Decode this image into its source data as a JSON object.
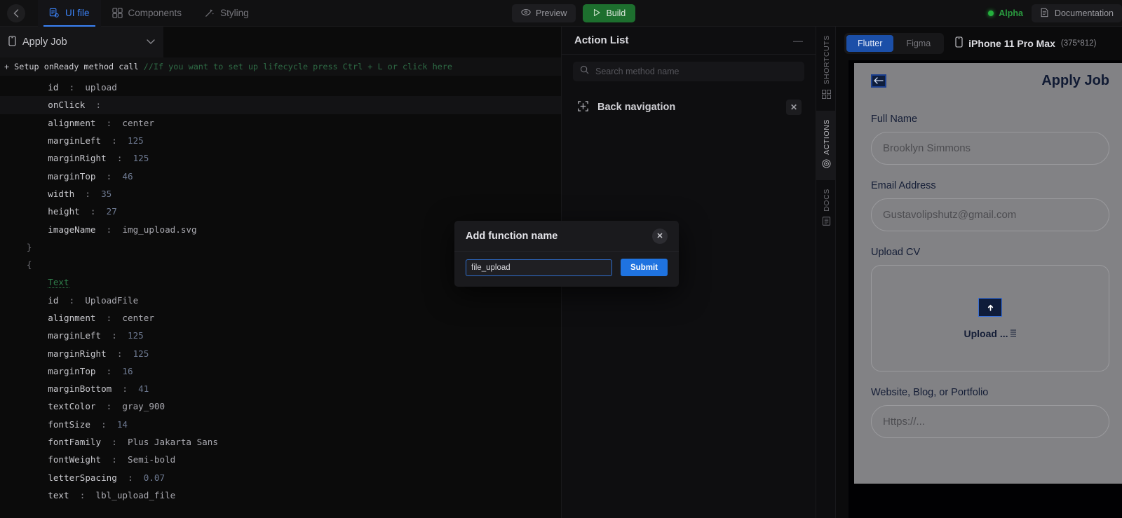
{
  "topbar": {
    "back_icon": "chevron-left-icon",
    "tabs": [
      {
        "label": "UI file",
        "icon": "ui-file-icon",
        "active": true
      },
      {
        "label": "Components",
        "icon": "components-grid-icon",
        "active": false
      },
      {
        "label": "Styling",
        "icon": "magic-wand-icon",
        "active": false
      }
    ],
    "preview_label": "Preview",
    "build_label": "Build",
    "alpha_label": "Alpha",
    "documentation_label": "Documentation"
  },
  "editor": {
    "file_name": "Apply Job",
    "onready": {
      "plus": "+",
      "label": "Setup onReady method call",
      "comment": "//If you want to set up lifecycle press Ctrl + L or click here"
    },
    "lines": [
      {
        "indent": 3,
        "key": "id",
        "colon": ":",
        "value": "upload",
        "vtype": "str",
        "hl": false
      },
      {
        "indent": 3,
        "key": "onClick",
        "colon": ":",
        "value": "",
        "vtype": "str",
        "hl": true
      },
      {
        "indent": 3,
        "key": "alignment",
        "colon": ":",
        "value": "center",
        "vtype": "str",
        "hl": false
      },
      {
        "indent": 3,
        "key": "marginLeft",
        "colon": ":",
        "value": "125",
        "vtype": "num",
        "hl": false
      },
      {
        "indent": 3,
        "key": "marginRight",
        "colon": ":",
        "value": "125",
        "vtype": "num",
        "hl": false
      },
      {
        "indent": 3,
        "key": "marginTop",
        "colon": ":",
        "value": "46",
        "vtype": "num",
        "hl": false
      },
      {
        "indent": 3,
        "key": "width",
        "colon": ":",
        "value": "35",
        "vtype": "num",
        "hl": false
      },
      {
        "indent": 3,
        "key": "height",
        "colon": ":",
        "value": "27",
        "vtype": "num",
        "hl": false
      },
      {
        "indent": 3,
        "key": "imageName",
        "colon": ":",
        "value": "img_upload.svg",
        "vtype": "str",
        "hl": false
      },
      {
        "indent": 2,
        "brace": "}",
        "hl": false
      },
      {
        "indent": 2,
        "brace": "{",
        "hl": false
      },
      {
        "indent": 3,
        "type": "Text",
        "hl": false
      },
      {
        "indent": 3,
        "key": "id",
        "colon": ":",
        "value": "UploadFile",
        "vtype": "str",
        "hl": false
      },
      {
        "indent": 3,
        "key": "alignment",
        "colon": ":",
        "value": "center",
        "vtype": "str",
        "hl": false
      },
      {
        "indent": 3,
        "key": "marginLeft",
        "colon": ":",
        "value": "125",
        "vtype": "num",
        "hl": false
      },
      {
        "indent": 3,
        "key": "marginRight",
        "colon": ":",
        "value": "125",
        "vtype": "num",
        "hl": false
      },
      {
        "indent": 3,
        "key": "marginTop",
        "colon": ":",
        "value": "16",
        "vtype": "num",
        "hl": false
      },
      {
        "indent": 3,
        "key": "marginBottom",
        "colon": ":",
        "value": "41",
        "vtype": "num",
        "hl": false
      },
      {
        "indent": 3,
        "key": "textColor",
        "colon": ":",
        "value": "gray_900",
        "vtype": "str",
        "hl": false
      },
      {
        "indent": 3,
        "key": "fontSize",
        "colon": ":",
        "value": "14",
        "vtype": "num",
        "hl": false
      },
      {
        "indent": 3,
        "key": "fontFamily",
        "colon": ":",
        "value": "Plus Jakarta Sans",
        "vtype": "str",
        "hl": false
      },
      {
        "indent": 3,
        "key": "fontWeight",
        "colon": ":",
        "value": "Semi-bold",
        "vtype": "str",
        "hl": false
      },
      {
        "indent": 3,
        "key": "letterSpacing",
        "colon": ":",
        "value": "0.07",
        "vtype": "num",
        "hl": false
      },
      {
        "indent": 3,
        "key": "text",
        "colon": ":",
        "value": "lbl_upload_file",
        "vtype": "str",
        "hl": false
      }
    ]
  },
  "action_list": {
    "title": "Action List",
    "search_placeholder": "Search method name",
    "search_value": "",
    "items": [
      {
        "label": "Back navigation",
        "icon": "back-navigation-icon"
      }
    ]
  },
  "rail": {
    "items": [
      {
        "label": "SHORTCUTS",
        "icon": "grid-icon",
        "active": false
      },
      {
        "label": "ACTIONS",
        "icon": "target-icon",
        "active": true
      },
      {
        "label": "DOCS",
        "icon": "doc-icon",
        "active": false
      }
    ]
  },
  "preview": {
    "segments": [
      {
        "label": "Flutter",
        "active": true
      },
      {
        "label": "Figma",
        "active": false
      }
    ],
    "device_name": "iPhone 11 Pro Max",
    "device_size": "(375*812)",
    "screen": {
      "title": "Apply Job",
      "back_icon": "back-arrow-icon",
      "fields": [
        {
          "label": "Full Name",
          "value": "Brooklyn Simmons"
        },
        {
          "label": "Email Address",
          "value": "Gustavolipshutz@gmail.com"
        }
      ],
      "upload": {
        "label": "Upload CV",
        "icon": "upload-arrow-icon",
        "text": "Upload ..."
      },
      "portfolio": {
        "label": "Website, Blog, or Portfolio",
        "value": "Https://..."
      }
    }
  },
  "modal": {
    "title": "Add function name",
    "close_icon": "close-icon",
    "input_value": "file_upload",
    "input_placeholder": "",
    "submit_label": "Submit"
  },
  "colors": {
    "accent_blue": "#3b82f6",
    "submit_blue": "#1f73e0",
    "build_green": "#1d6f2e",
    "alpha_green": "#2a9a3f"
  }
}
